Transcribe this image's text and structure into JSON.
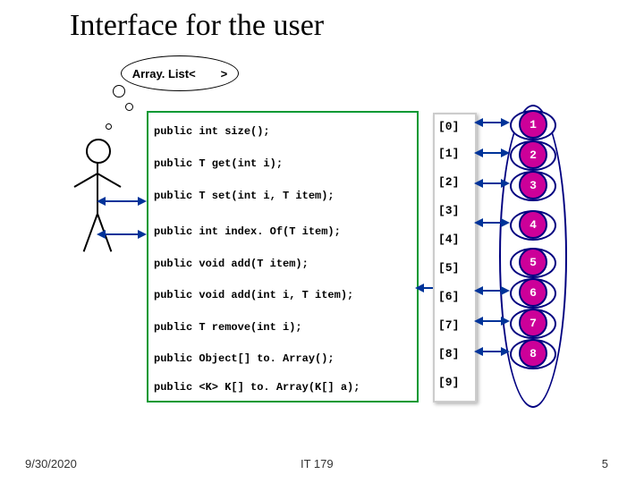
{
  "title": "Interface for the user",
  "cloud": {
    "prefix": "Array. List<",
    "suffix": " >"
  },
  "methods": [
    "public int size();",
    "public T get(int i);",
    "public T set(int i, T item);",
    "public int index. Of(T item);",
    "public void add(T item);",
    "public void add(int i, T item);",
    "public T remove(int i);",
    "public Object[] to. Array();",
    "public <K> K[] to. Array(K[] a);"
  ],
  "indices": [
    "[0]",
    "[1]",
    "[2]",
    "[3]",
    "[4]",
    "[5]",
    "[6]",
    "[7]",
    "[8]",
    "[9]"
  ],
  "values": [
    "1",
    "2",
    "3",
    "4",
    "5",
    "6",
    "7",
    "8"
  ],
  "footer": {
    "date": "9/30/2020",
    "course": "IT 179",
    "page": "5"
  }
}
